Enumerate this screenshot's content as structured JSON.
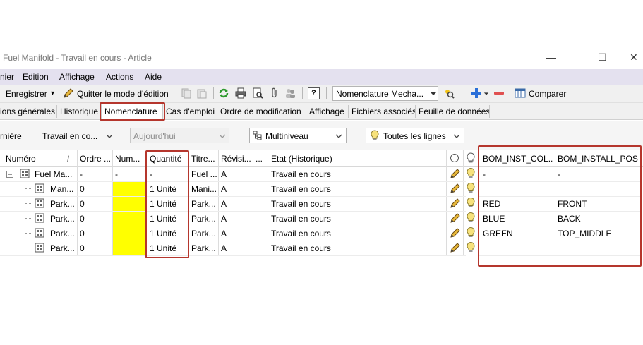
{
  "window": {
    "title": "Fuel Manifold - Travail en cours - Article",
    "minimize": "—",
    "maximize": "☐",
    "close": "✕"
  },
  "menu": [
    "nier",
    "Edition",
    "Affichage",
    "Actions",
    "Aide"
  ],
  "toolbar": {
    "save_label": "Enregistrer",
    "save_arrow": "▾",
    "quit_edit_label": "Quitter le mode d'édition",
    "help_label": "?",
    "view_select_value": "Nomenclature Mecha...",
    "compare_label": "Comparer"
  },
  "tabs": [
    "ions générales",
    "Historique",
    "Nomenclature",
    "Cas d'emploi",
    "Ordre de modification",
    "Affichage",
    "Fichiers associés",
    "Feuille de données"
  ],
  "active_tab": "Nomenclature",
  "filters": {
    "revision_label": "rnière",
    "state_value": "Travail en co...",
    "date_value": "Aujourd'hui",
    "level_value": "Multiniveau",
    "lines_value": "Toutes les lignes"
  },
  "grid": {
    "columns": [
      "Numéro",
      "/",
      "Ordre ...",
      "Num...",
      "Quantité",
      "Titre...",
      "Révisi...",
      "...",
      "Etat (Historique)",
      "BOM_INST_COL...",
      "BOM_INSTALL_POS"
    ],
    "rows": [
      {
        "numero": "Fuel Ma...",
        "ordre": "-",
        "num": "-",
        "quantite": "-",
        "titre": "Fuel ...",
        "revision": "A",
        "etat": "Travail en cours",
        "col": "-",
        "pos": "-",
        "root": true
      },
      {
        "numero": "Man...",
        "ordre": "0",
        "num": "",
        "quantite": "1 Unité",
        "titre": "Mani...",
        "revision": "A",
        "etat": "Travail en cours",
        "col": "",
        "pos": ""
      },
      {
        "numero": "Park...",
        "ordre": "0",
        "num": "",
        "quantite": "1 Unité",
        "titre": "Park...",
        "revision": "A",
        "etat": "Travail en cours",
        "col": "RED",
        "pos": "FRONT"
      },
      {
        "numero": "Park...",
        "ordre": "0",
        "num": "",
        "quantite": "1 Unité",
        "titre": "Park...",
        "revision": "A",
        "etat": "Travail en cours",
        "col": "BLUE",
        "pos": "BACK"
      },
      {
        "numero": "Park...",
        "ordre": "0",
        "num": "",
        "quantite": "1 Unité",
        "titre": "Park...",
        "revision": "A",
        "etat": "Travail en cours",
        "col": "GREEN",
        "pos": "TOP_MIDDLE"
      },
      {
        "numero": "Park...",
        "ordre": "0",
        "num": "",
        "quantite": "1 Unité",
        "titre": "Park...",
        "revision": "A",
        "etat": "Travail en cours",
        "col": "",
        "pos": ""
      }
    ]
  },
  "colors": {
    "highlight_yellow": "#ffff00",
    "annotation_red": "#b5362d",
    "menubar_bg": "#e4e1ef"
  },
  "icons": [
    "save-icon",
    "pencil-icon",
    "refresh-icon",
    "print-icon",
    "print-preview-icon",
    "attach-icon",
    "help-icon",
    "add-icon",
    "remove-icon",
    "compare-icon",
    "tree-collapse-icon",
    "assembly-icon",
    "part-icon",
    "edit-pencil-icon",
    "lightbulb-icon",
    "status-circle-icon",
    "multilevel-icon"
  ]
}
